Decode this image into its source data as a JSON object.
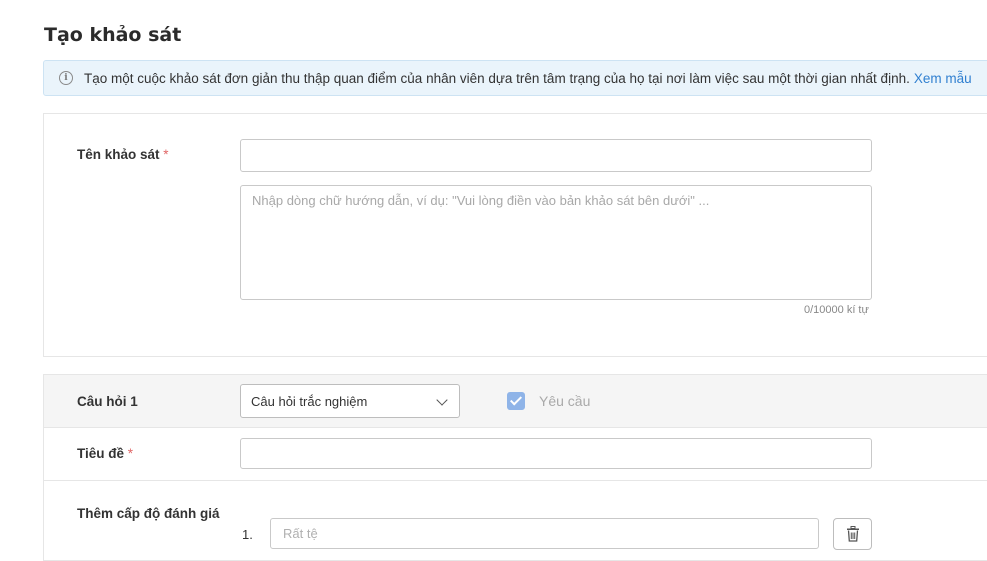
{
  "page": {
    "title": "Tạo khảo sát"
  },
  "info_banner": {
    "icon": "info-circle-icon",
    "text": "Tạo một cuộc khảo sát đơn giản thu thập quan điểm của nhân viên dựa trên tâm trạng của họ tại nơi làm việc sau một thời gian nhất định.",
    "link_label": "Xem mẫu"
  },
  "survey": {
    "name_label": "Tên khảo sát",
    "required_mark": "*",
    "name_value": "",
    "description_placeholder": "Nhập dòng chữ hướng dẫn, ví dụ: \"Vui lòng điền vào bản khảo sát bên dưới\" ...",
    "description_counter": "0/10000 kí tự"
  },
  "question": {
    "label": "Câu hỏi 1",
    "type_selected": "Câu hỏi trắc nghiệm",
    "required_checked": true,
    "required_label": "Yêu cầu",
    "title_label": "Tiêu đề",
    "title_required_mark": "*",
    "title_value": "",
    "levels_label": "Thêm cấp độ đánh giá",
    "levels": [
      {
        "number": "1.",
        "placeholder": "Rất tệ",
        "value": ""
      }
    ]
  }
}
